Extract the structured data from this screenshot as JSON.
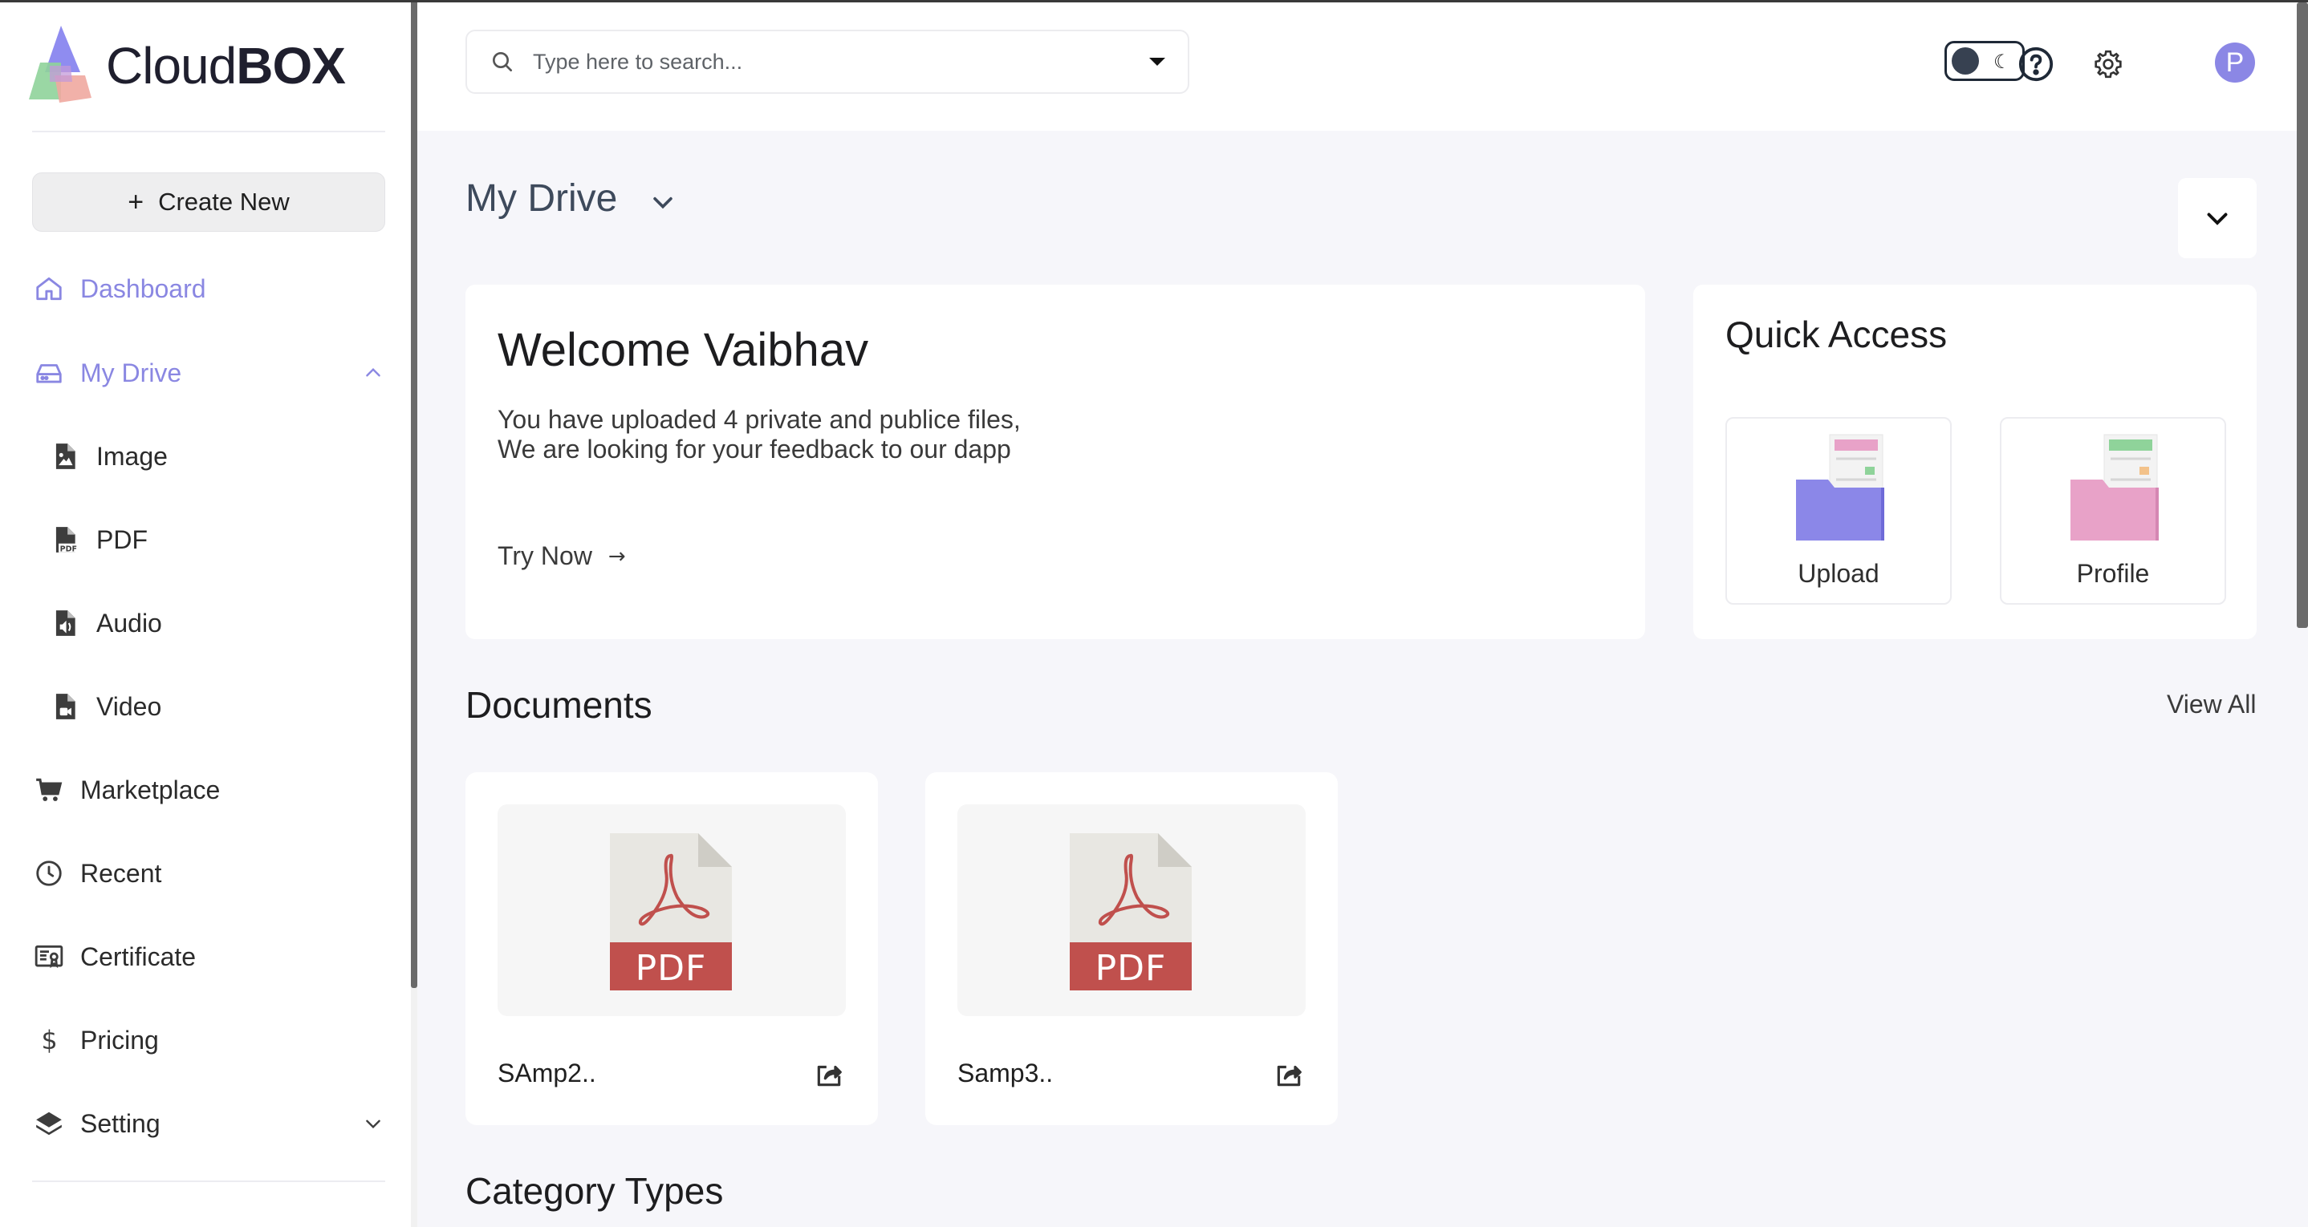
{
  "app": {
    "name_light": "Cloud",
    "name_bold": "BOX"
  },
  "sidebar": {
    "create_label": "Create New",
    "items": [
      {
        "label": "Dashboard",
        "icon": "home-icon",
        "active": true
      },
      {
        "label": "My Drive",
        "icon": "drive-icon",
        "active": true,
        "expanded": true
      },
      {
        "label": "Image",
        "icon": "image-file-icon"
      },
      {
        "label": "PDF",
        "icon": "pdf-file-icon"
      },
      {
        "label": "Audio",
        "icon": "audio-file-icon"
      },
      {
        "label": "Video",
        "icon": "video-file-icon"
      },
      {
        "label": "Marketplace",
        "icon": "cart-icon"
      },
      {
        "label": "Recent",
        "icon": "clock-icon"
      },
      {
        "label": "Certificate",
        "icon": "certificate-icon"
      },
      {
        "label": "Pricing",
        "icon": "dollar-icon"
      },
      {
        "label": "Setting",
        "icon": "layers-icon",
        "expanded": false
      }
    ]
  },
  "header": {
    "search_placeholder": "Type here to search...",
    "avatar_letter": "P"
  },
  "main": {
    "drive_title": "My Drive",
    "welcome": {
      "title": "Welcome Vaibhav",
      "line1": "You have uploaded 4 private and publice files,",
      "line2": "We are looking for your feedback to our dapp",
      "cta": "Try Now"
    },
    "quick_access": {
      "title": "Quick Access",
      "tiles": [
        {
          "label": "Upload",
          "color": "#8b87e8"
        },
        {
          "label": "Profile",
          "color": "#e8a2c8"
        }
      ]
    },
    "documents": {
      "title": "Documents",
      "view_all": "View All",
      "files": [
        {
          "name": "SAmp2..",
          "type_label": "PDF"
        },
        {
          "name": "Samp3..",
          "type_label": "PDF"
        }
      ]
    },
    "category_title": "Category Types"
  },
  "colors": {
    "accent": "#8a87e2",
    "pdf_red": "#c0504d",
    "page_bg": "#f6f6fa"
  }
}
